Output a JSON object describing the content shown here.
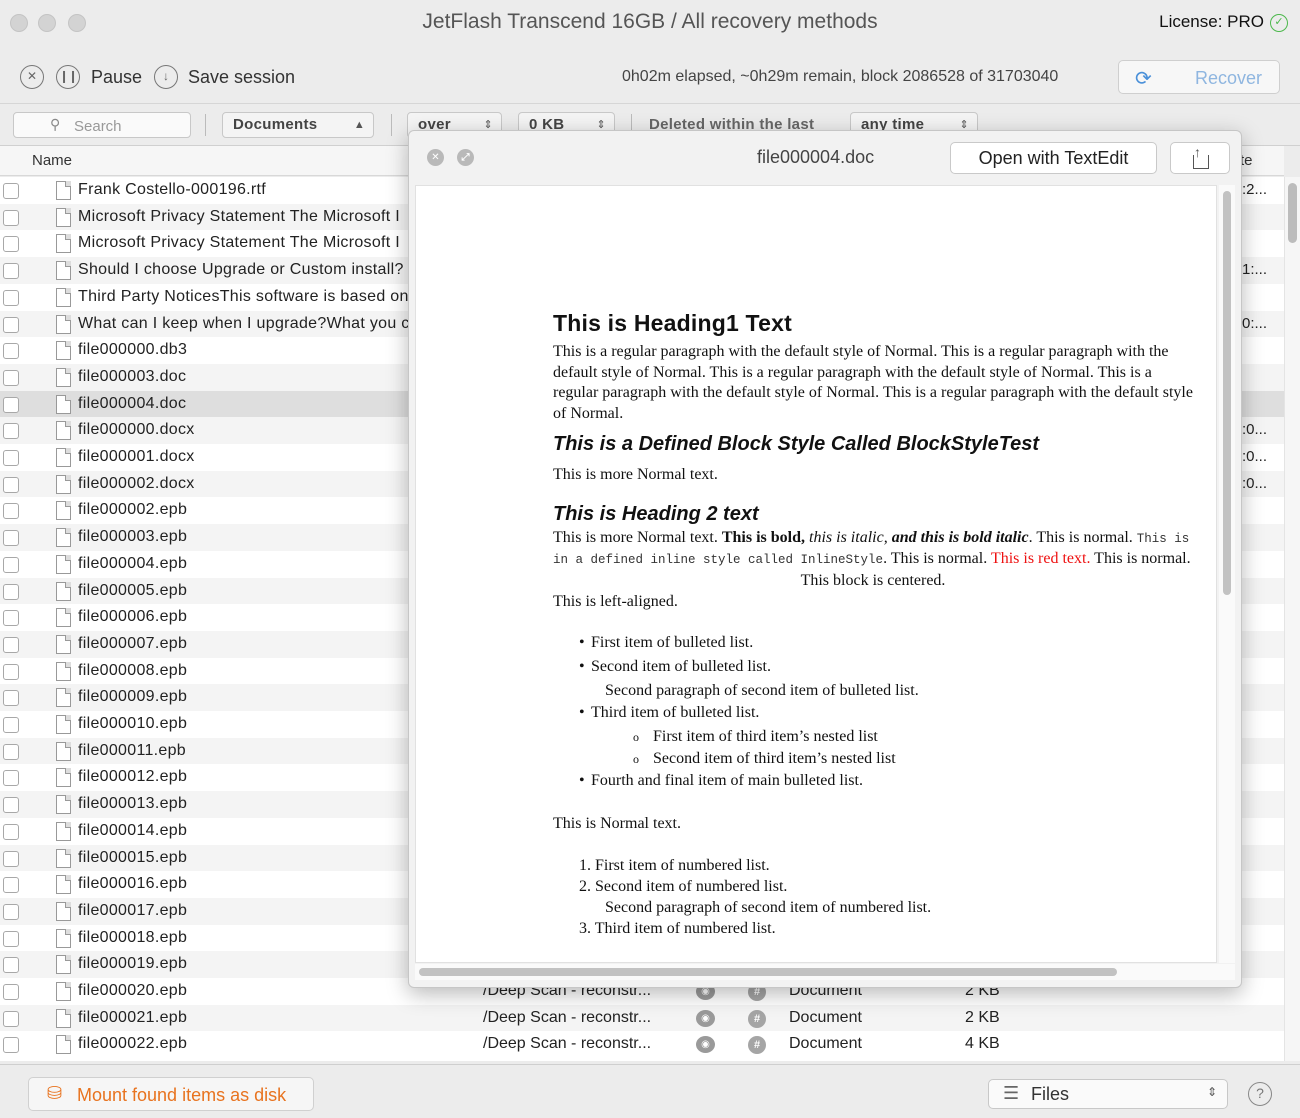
{
  "window": {
    "title": "JetFlash Transcend 16GB / All recovery methods",
    "license": "License: PRO"
  },
  "toolbar": {
    "pause_label": "Pause",
    "save_label": "Save session",
    "progress_text": "0h02m elapsed, ~0h29m remain, block 2086528 of 31703040",
    "recover_label": "Recover"
  },
  "filters": {
    "search_placeholder": "Search",
    "type": "Documents",
    "size_op": "over",
    "size_value": "0 KB",
    "deleted_label": "Deleted within the last",
    "time_value": "any time"
  },
  "table": {
    "name_header": "Name",
    "date_header": "te",
    "rows": [
      {
        "name": "Frank Costello-000196.rtf",
        "date": ":2..."
      },
      {
        "name": "Microsoft Privacy Statement The Microsoft I",
        "date": ""
      },
      {
        "name": "Microsoft Privacy Statement The Microsoft I",
        "date": ""
      },
      {
        "name": "Should I choose Upgrade or Custom install?",
        "date": "1:..."
      },
      {
        "name": "Third Party NoticesThis software is based on",
        "date": ""
      },
      {
        "name": "What can I keep when I upgrade?What you c",
        "date": "0:..."
      },
      {
        "name": "file000000.db3",
        "date": ""
      },
      {
        "name": "file000003.doc",
        "date": ""
      },
      {
        "name": "file000004.doc",
        "date": ""
      },
      {
        "name": "file000000.docx",
        "date": ":0..."
      },
      {
        "name": "file000001.docx",
        "date": ":0..."
      },
      {
        "name": "file000002.docx",
        "date": ":0..."
      },
      {
        "name": "file000002.epb",
        "date": ""
      },
      {
        "name": "file000003.epb",
        "date": ""
      },
      {
        "name": "file000004.epb",
        "date": ""
      },
      {
        "name": "file000005.epb",
        "date": ""
      },
      {
        "name": "file000006.epb",
        "date": ""
      },
      {
        "name": "file000007.epb",
        "date": ""
      },
      {
        "name": "file000008.epb",
        "date": ""
      },
      {
        "name": "file000009.epb",
        "date": ""
      },
      {
        "name": "file000010.epb",
        "date": ""
      },
      {
        "name": "file000011.epb",
        "date": ""
      },
      {
        "name": "file000012.epb",
        "date": ""
      },
      {
        "name": "file000013.epb",
        "date": ""
      },
      {
        "name": "file000014.epb",
        "date": ""
      },
      {
        "name": "file000015.epb",
        "date": ""
      },
      {
        "name": "file000016.epb",
        "date": ""
      },
      {
        "name": "file000017.epb",
        "date": ""
      },
      {
        "name": "file000018.epb",
        "date": ""
      },
      {
        "name": "file000019.epb",
        "date": ""
      },
      {
        "name": "file000020.epb",
        "path": "/Deep Scan - reconstr...",
        "kind": "Document",
        "size": "2 KB"
      },
      {
        "name": "file000021.epb",
        "path": "/Deep Scan - reconstr...",
        "kind": "Document",
        "size": "2 KB"
      },
      {
        "name": "file000022.epb",
        "path": "/Deep Scan - reconstr...",
        "kind": "Document",
        "size": "4 KB"
      }
    ]
  },
  "bottom": {
    "mount_label": "Mount found items as disk",
    "view_select": "Files"
  },
  "preview": {
    "title": "file000004.doc",
    "open_label": "Open with TextEdit",
    "doc": {
      "h1": "This is Heading1 Text",
      "p1": "This is a regular paragraph with the default style of Normal. This is a regular paragraph with the default style of Normal. This is a regular paragraph with the default style of Normal. This is a regular paragraph with the default style of Normal. This is a regular paragraph with the default style of Normal.",
      "block_style": "This is a Defined Block Style Called BlockStyleTest",
      "more_normal": "This is more Normal text.",
      "h2": "This is Heading 2 text",
      "p2_a": "This is more Normal text. ",
      "p2_bold": "This is bold, ",
      "p2_italic": "this is italic, ",
      "p2_bolditalic": "and this is bold italic",
      "p2_b": ". This is normal. ",
      "p2_mono": "This is in a defined inline style called InlineStyle",
      "p2_c": ". This is normal. ",
      "p2_red": "This is red text.",
      "p2_d": " This is normal.",
      "centered": "This block is centered.",
      "left": "This is left-aligned.",
      "bullet1": "First item of bulleted list.",
      "bullet2": "Second item of bulleted list.",
      "bullet2_para": "Second paragraph of second item of bulleted list.",
      "bullet3": "Third item of bulleted list.",
      "nested1": "First item of third item’s nested list",
      "nested2": "Second item of third item’s nested list",
      "bullet4": "Fourth and final item of main bulleted list.",
      "normal2": "This is Normal text.",
      "num1": "First item of numbered list.",
      "num2": "Second item of numbered list.",
      "num2_para": "Second paragraph of second item of numbered list.",
      "num3": "Third item of numbered list."
    }
  }
}
